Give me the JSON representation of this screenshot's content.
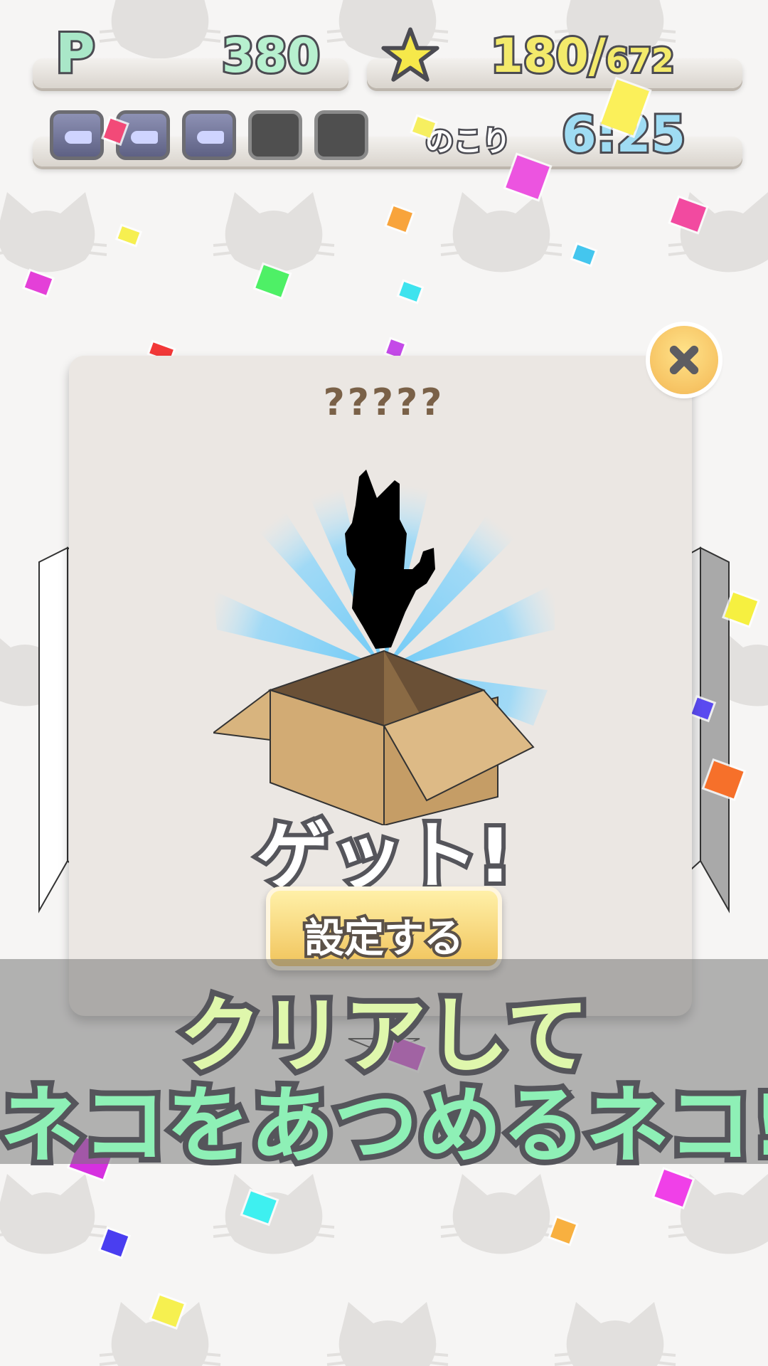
{
  "hud": {
    "points_label": "P",
    "points": "380",
    "stars_count": "180/",
    "stars_total": "672",
    "remaining_label": "のこり",
    "timer": "6:25",
    "fish_slots": [
      "full",
      "full",
      "full",
      "empty",
      "empty"
    ]
  },
  "modal": {
    "title": "?????",
    "result_text": "ゲット!",
    "set_button_label": "設定する"
  },
  "banner": {
    "line1": "クリアして",
    "line2": "ネコをあつめるネコ!"
  },
  "colors": {
    "accent_green": "#8ef0b6",
    "accent_yellow": "#f3ea6b",
    "accent_blue": "#9fdcf3",
    "button_gold": "#f1c45c"
  }
}
